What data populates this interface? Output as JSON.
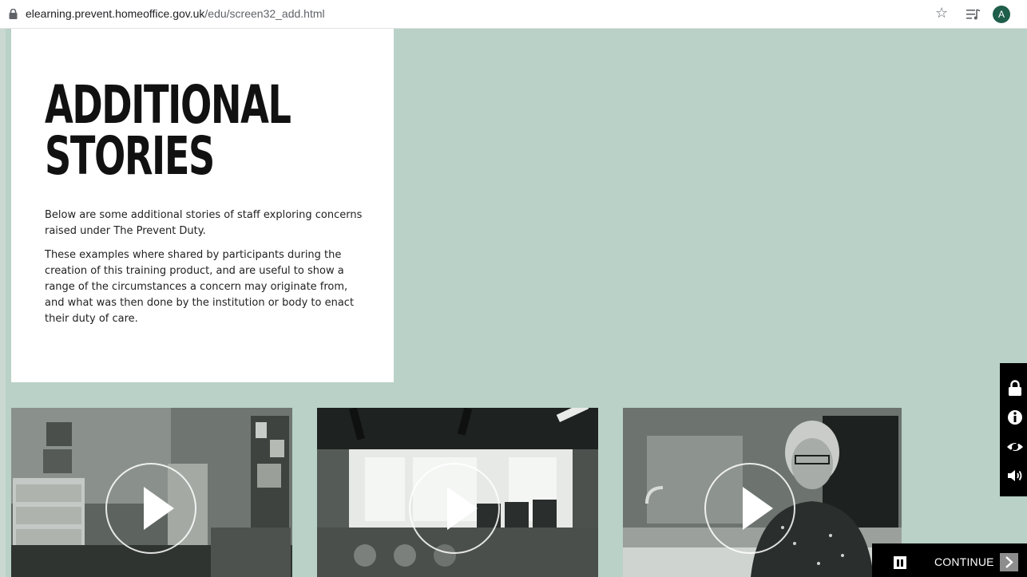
{
  "browser": {
    "url_host": "elearning.prevent.homeoffice.gov.uk",
    "url_path": "/edu/screen32_add.html",
    "avatar_initial": "A",
    "icons": [
      "lock-icon",
      "star-icon",
      "media-control-icon"
    ]
  },
  "intro": {
    "title_line1": "ADDITIONAL",
    "title_line2": "STORIES",
    "paragraph1": "Below are some additional stories of staff exploring concerns raised under The Prevent Duty.",
    "paragraph2": "These examples where shared by participants during the creation of this training product, and are useful to show a range of the circumstances a concern may originate from, and what was then done by the institution or body to enact their duty of care."
  },
  "videos": [
    {
      "thumbnail": "office-filing-cabinets",
      "icon": "play-icon"
    },
    {
      "thumbnail": "computer-classroom",
      "icon": "play-icon"
    },
    {
      "thumbnail": "woman-speaking-in-lab",
      "icon": "play-icon"
    }
  ],
  "side_toolbar": {
    "icons": [
      "lock-icon",
      "info-icon",
      "visibility-icon",
      "audio-icon"
    ]
  },
  "controls": {
    "continue_label": "CONTINUE",
    "icons": [
      "pause-icon",
      "chevron-right-icon"
    ]
  },
  "colors": {
    "page_background": "#b9d1c7",
    "card_background": "#ffffff",
    "toolbar_background": "#000000",
    "avatar": "#1f5e4b",
    "continue_arrow": "#8d8d8d"
  }
}
